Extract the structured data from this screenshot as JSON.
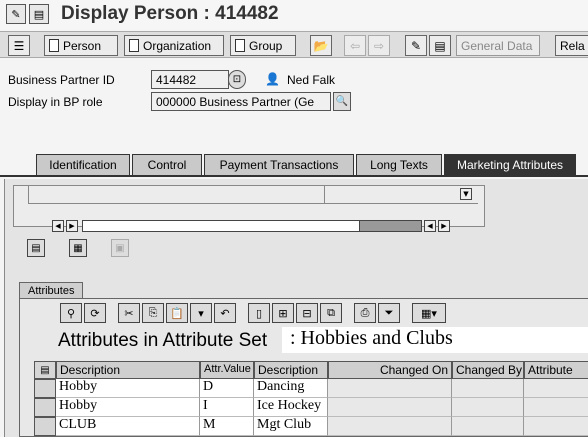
{
  "window": {
    "title": "Display Person : 414482"
  },
  "toolbar": {
    "person_label": "Person",
    "organization_label": "Organization",
    "group_label": "Group",
    "general_data_label": "General Data",
    "relationships_label": "Rela"
  },
  "header_fields": {
    "bp_id_label": "Business Partner ID",
    "bp_id_value": "414482",
    "partner_name": "Ned Falk",
    "bp_role_label": "Display in BP role",
    "bp_role_value": "000000 Business Partner (Ge"
  },
  "tabs": [
    {
      "label": "Identification",
      "active": false
    },
    {
      "label": "Control",
      "active": false
    },
    {
      "label": "Payment Transactions",
      "active": false
    },
    {
      "label": "Long Texts",
      "active": false
    },
    {
      "label": "Marketing Attributes",
      "active": true
    }
  ],
  "attributes": {
    "section_tab_label": "Attributes",
    "grid_title": "Attributes in Attribute Set",
    "attribute_set_value": ": Hobbies and Clubs",
    "columns": [
      "Description",
      "Attr.Value",
      "Description",
      "Changed On",
      "Changed By",
      "Attribute"
    ],
    "rows": [
      {
        "description": "Hobby",
        "value": "D",
        "value_description": "Dancing",
        "changed_on": "",
        "changed_by": "",
        "attribute": ""
      },
      {
        "description": "Hobby",
        "value": "I",
        "value_description": "Ice Hockey",
        "changed_on": "",
        "changed_by": "",
        "attribute": ""
      },
      {
        "description": "CLUB",
        "value": "M",
        "value_description": "Mgt Club",
        "changed_on": "",
        "changed_by": "",
        "attribute": ""
      }
    ]
  },
  "colors": {
    "active_tab": "#333333",
    "inactive_tab": "#c9c9c9",
    "background": "#f4f4f4"
  }
}
